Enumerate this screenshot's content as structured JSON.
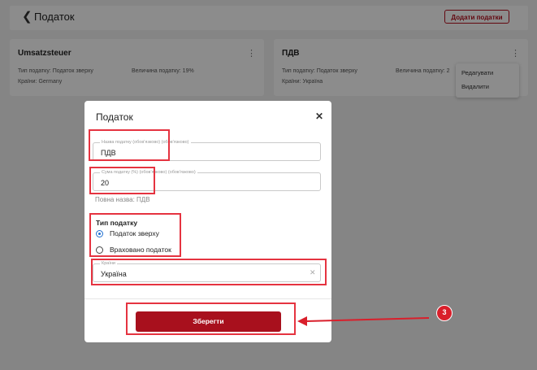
{
  "header": {
    "back_icon": "chevron-left-icon",
    "title": "Податок",
    "add_button": "Додати податки"
  },
  "cards": [
    {
      "title": "Umsatzsteuer",
      "type_text": "Тип податку: Податок зверху",
      "value_text": "Величина податку: 19%",
      "country_text": "Країни: Germany"
    },
    {
      "title": "ПДВ",
      "type_text": "Тип податку: Податок зверху",
      "value_text": "Величина податку: 2",
      "country_text": "Країни: Україна"
    }
  ],
  "context_menu": {
    "edit": "Редагувати",
    "delete": "Видалити"
  },
  "modal": {
    "title": "Податок",
    "close_icon": "close-icon",
    "name_field": {
      "label": "Назва податку (обов'язково) (обов'язково)",
      "value": "ПДВ"
    },
    "amount_field": {
      "label": "Сума податку (%) (обов'язково) (обов'язково)",
      "value": "20"
    },
    "full_name": "Повна назва: ПДВ",
    "tax_type": {
      "label": "Тип податку",
      "options": [
        {
          "label": "Податок зверху",
          "selected": true
        },
        {
          "label": "Враховано податок",
          "selected": false
        }
      ]
    },
    "country_field": {
      "label": "Країни",
      "value": "Україна",
      "clear_icon": "close-icon"
    },
    "save_button": "Зберегти"
  },
  "annotation": {
    "step": "3"
  },
  "colors": {
    "brand": "#a8101d",
    "highlight": "#e53340",
    "radio_selected": "#1f6fd0"
  }
}
